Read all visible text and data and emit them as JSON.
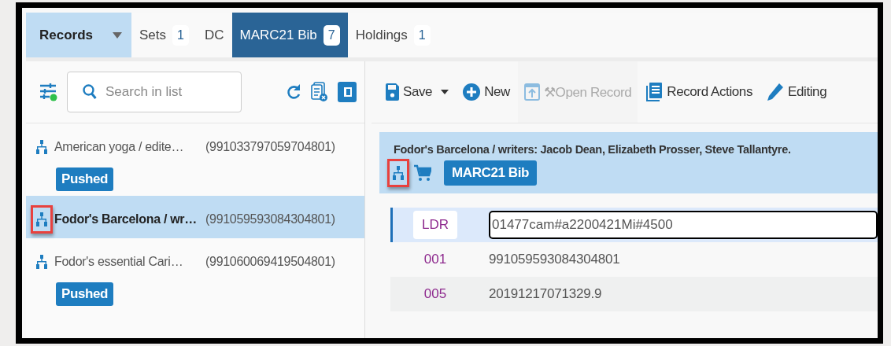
{
  "tabs": [
    {
      "label": "Records",
      "kind": "menu",
      "selected": false
    },
    {
      "label": "Sets",
      "count": "1",
      "kind": "tab",
      "selected": false
    },
    {
      "label": "DC",
      "kind": "tab",
      "selected": false
    },
    {
      "label": "MARC21 Bib",
      "count": "7",
      "kind": "tab",
      "selected": true
    },
    {
      "label": "Holdings",
      "count": "1",
      "kind": "tab",
      "selected": false
    }
  ],
  "search": {
    "placeholder": "Search in list"
  },
  "records": [
    {
      "title": "American yoga / edite…",
      "id": "(991033797059704801)",
      "badge": "Pushed",
      "selected": false,
      "highlighted": false
    },
    {
      "title": "Fodor's Barcelona / wr…",
      "id": "(991059593084304801)",
      "selected": true,
      "highlighted": true
    },
    {
      "title": "Fodor's essential Cari…",
      "id": "(991060069419504801)",
      "badge": "Pushed",
      "selected": false,
      "highlighted": false
    }
  ],
  "toolbar": [
    {
      "kind": "save",
      "label": "Save",
      "disabled": false
    },
    {
      "kind": "new",
      "label": "New",
      "disabled": false
    },
    {
      "kind": "open",
      "label": "⚒Open Record",
      "disabled": true
    },
    {
      "kind": "actions",
      "label": "Record Actions",
      "disabled": false
    },
    {
      "kind": "edit",
      "label": "Editing",
      "disabled": false
    }
  ],
  "record": {
    "title": "Fodor's Barcelona / writers: Jacob Dean, Elizabeth Prosser, Steve Tallantyre.",
    "badge": "MARC21 Bib",
    "highlighted": true
  },
  "fields": [
    {
      "tag": "LDR",
      "value": "01477cam#a2200421Mi#4500",
      "kind": "input",
      "selected": true
    },
    {
      "tag": "001",
      "value": "991059593084304801",
      "kind": "text",
      "selected": false
    },
    {
      "tag": "005",
      "value": "20191217071329.9",
      "kind": "text",
      "selected": false
    }
  ]
}
